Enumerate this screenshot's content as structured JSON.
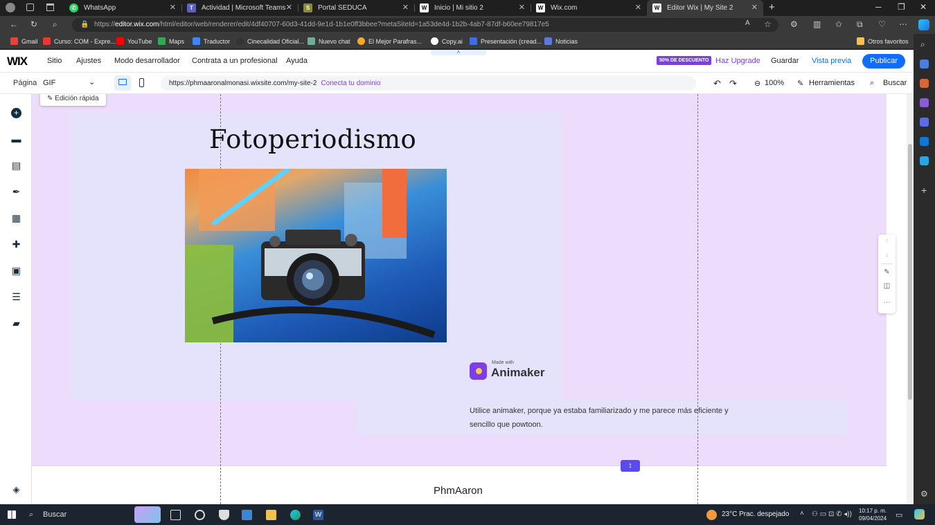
{
  "browser": {
    "tabs": [
      {
        "label": "WhatsApp",
        "favicon": "whatsapp-icon",
        "color": "#25d366"
      },
      {
        "label": "Actividad | Microsoft Teams",
        "favicon": "teams-icon",
        "color": "#5b5fc7"
      },
      {
        "label": "Portal SEDUCA",
        "favicon": "seduca-icon",
        "color": "#8a8a3a"
      },
      {
        "label": "Inicio | Mi sitio 2",
        "favicon": "wix-icon",
        "color": "#ffffff"
      },
      {
        "label": "Wix.com",
        "favicon": "wix-icon",
        "color": "#ffffff"
      },
      {
        "label": "Editor Wix | My Site 2",
        "favicon": "wix-icon",
        "color": "#ffffff"
      }
    ],
    "url_prefix": "https://",
    "url_host": "editor.wix.com",
    "url_rest": "/html/editor/web/renderer/edit/4df40707-60d3-41dd-9e1d-1b1e0ff3bbee?metaSiteId=1a53de4d-1b2b-4ab7-87df-b60ee79817e5",
    "bookmarks": [
      "Gmail",
      "Curso: COM - Expre...",
      "YouTube",
      "Maps",
      "Traductor",
      "Cinecalidad Oficial...",
      "Nuevo chat",
      "El Mejor Parafras...",
      "Copy.ai",
      "Presentación (cread...",
      "Noticias"
    ],
    "other_favorites": "Otros favoritos"
  },
  "wix": {
    "logo": "WIX",
    "menu": [
      "Sitio",
      "Ajustes",
      "Modo desarrollador",
      "Contrata a un profesional",
      "Ayuda"
    ],
    "discount_badge": "50% DE DESCUENTO",
    "upgrade": "Haz Upgrade",
    "save": "Guardar",
    "preview": "Vista previa",
    "publish": "Publicar",
    "page_label": "Página",
    "page_value": "GIF",
    "site_url": "https://phmaaronalmonasi.wixsite.com/my-site-2",
    "connect_domain": "Conecta tu dominio",
    "zoom": "100%",
    "tools": "Herramientas",
    "search": "Buscar"
  },
  "canvas": {
    "quick_edit": "Edición rápida",
    "title": "Fotoperiodismo",
    "animaker_small": "Made with",
    "animaker_big": "Animaker",
    "description": "Utilice animaker, porque ya estaba familiarizado y me parece más eficiente y sencillo que powtoon.",
    "footer_name": "PhmAaron"
  },
  "taskbar": {
    "search": "Buscar",
    "weather": "23°C  Prac. despejado",
    "time": "10:17 p. m.",
    "date": "09/04/2024"
  }
}
